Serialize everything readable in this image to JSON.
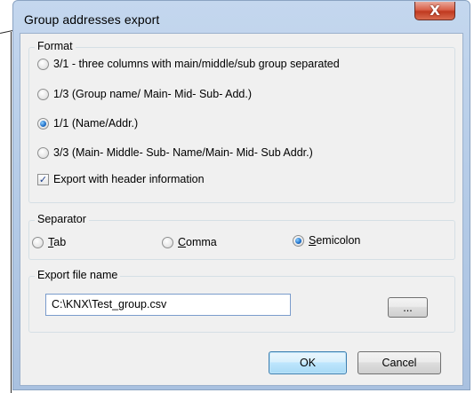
{
  "window": {
    "title": "Group addresses export",
    "close_glyph": "X"
  },
  "format": {
    "legend": "Format",
    "options": [
      {
        "label": "3/1 - three columns with main/middle/sub group separated",
        "checked": false
      },
      {
        "label": "1/3 (Group name/ Main-  Mid- Sub- Add.)",
        "checked": false
      },
      {
        "label": "1/1 (Name/Addr.)",
        "checked": true
      },
      {
        "label": "3/3 (Main- Middle- Sub- Name/Main- Mid- Sub Addr.)",
        "checked": false
      }
    ],
    "header_checkbox": {
      "label": "Export with header information",
      "checked": true
    }
  },
  "separator": {
    "legend": "Separator",
    "tab": {
      "accel": "T",
      "rest": "ab",
      "checked": false
    },
    "comma": {
      "accel": "C",
      "rest": "omma",
      "checked": false
    },
    "semicolon": {
      "accel": "S",
      "rest": "emicolon",
      "checked": true
    }
  },
  "export_file": {
    "legend": "Export file name",
    "value": "C:\\KNX\\Test_group.csv",
    "browse_label": "..."
  },
  "buttons": {
    "ok": "OK",
    "cancel": "Cancel"
  },
  "icons": {
    "close": "close-icon",
    "check": "checkmark-icon"
  },
  "colors": {
    "frame": "#b7cde8",
    "close_button": "#c0391f",
    "radio_selected": "#1e6fc9",
    "client_bg": "#f0f0f0"
  }
}
